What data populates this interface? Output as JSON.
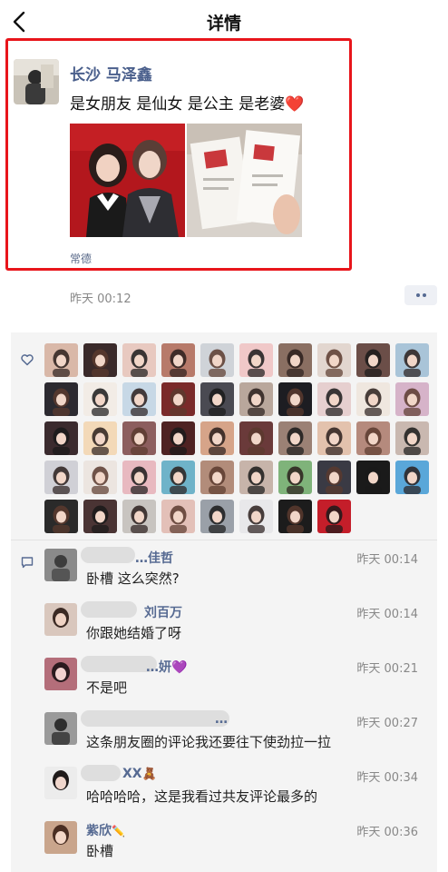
{
  "header": {
    "title": "详情",
    "back_icon": "chevron-left-icon"
  },
  "post": {
    "author": "长沙 马泽鑫",
    "text": "是女朋友 是仙女 是公主 是老婆",
    "text_emoji": "❤️",
    "location": "常德",
    "time": "昨天 00:12",
    "highlight_color": "#e8151b"
  },
  "likes": {
    "icon": "heart-outline-icon",
    "count": 48
  },
  "comments_icon": "comment-icon",
  "comments": [
    {
      "name": "…佳哲",
      "time": "昨天 00:14",
      "text": "卧槽 这么突然?"
    },
    {
      "name": "刘百万",
      "time": "昨天 00:14",
      "text": "你跟她结婚了呀"
    },
    {
      "name": "…妍",
      "name_emoji": "💜",
      "time": "昨天 00:21",
      "text": "不是吧"
    },
    {
      "name": "…",
      "name_emoji": "",
      "time": "昨天 00:27",
      "text": "这条朋友圈的评论我还要往下使劲拉一拉"
    },
    {
      "name": "XX",
      "name_emoji": "🧸",
      "time": "昨天 00:34",
      "text": "哈哈哈哈，这是我看过共友评论最多的"
    },
    {
      "name": "紫欣",
      "name_emoji": "✏️",
      "time": "昨天 00:36",
      "text": "卧槽"
    }
  ]
}
